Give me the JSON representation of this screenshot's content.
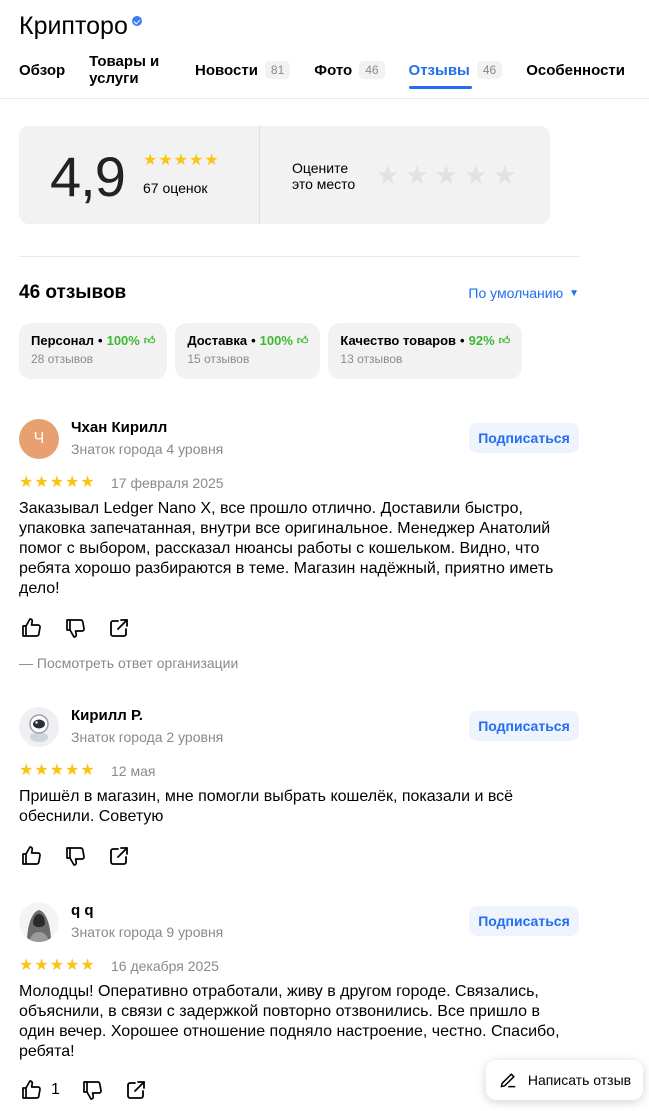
{
  "header": {
    "title": "Крипторо",
    "verified_icon": "verified-check-icon",
    "tabs": [
      {
        "label": "Обзор",
        "count": ""
      },
      {
        "label": "Товары и услуги",
        "count": ""
      },
      {
        "label": "Новости",
        "count": "81"
      },
      {
        "label": "Фото",
        "count": "46"
      },
      {
        "label": "Отзывы",
        "count": "46"
      },
      {
        "label": "Особенности",
        "count": ""
      }
    ],
    "active_tab": "Отзывы"
  },
  "rating": {
    "value": "4,9",
    "stars": 5,
    "count_label": "67 оценок",
    "rate_prompt_line1": "Оцените",
    "rate_prompt_line2": "это место",
    "rate_stars": 5
  },
  "reviews_section": {
    "title": "46 отзывов",
    "sort_label": "По умолчанию",
    "aspects": [
      {
        "name": "Персонал",
        "percent": "100%",
        "count": "28 отзывов"
      },
      {
        "name": "Доставка",
        "percent": "100%",
        "count": "15 отзывов"
      },
      {
        "name": "Качество товаров",
        "percent": "92%",
        "count": "13 отзывов"
      }
    ]
  },
  "reviews": [
    {
      "avatar_letter": "Ч",
      "name": "Чхан Кирилл",
      "level": "Знаток города 4 уровня",
      "subscribe_label": "Подписаться",
      "stars": 5,
      "date": "17 февраля 2025",
      "text": "Заказывал Ledger Nano X, все прошло отлично. Доставили быстро, упаковка запечатанная, внутри все оригинальное. Менеджер Анатолий помог с выбором, рассказал нюансы работы с кошельком. Видно, что ребята хорошо разбираются в теме. Магазин надёжный, приятно иметь дело!",
      "likes": "",
      "org_answer_label": "— Посмотреть ответ организации"
    },
    {
      "avatar_letter": "",
      "name": "Кирилл Р.",
      "level": "Знаток города 2 уровня",
      "subscribe_label": "Подписаться",
      "stars": 5,
      "date": "12 мая",
      "text": "Пришёл в магазин, мне помогли выбрать кошелёк, показали и всё обеснили. Советую",
      "likes": ""
    },
    {
      "avatar_letter": "",
      "name": "q q",
      "level": "Знаток города 9 уровня",
      "subscribe_label": "Подписаться",
      "stars": 5,
      "date": "16 декабря 2025",
      "text": "Молодцы! Оперативно отработали, живу в другом городе. Связались, объяснили, в связи с задержкой повторно отзвонились. Все пришло в один вечер. Хорошее отношение подняло настроение, честно. Спасибо, ребята!",
      "likes": "1"
    }
  ],
  "write_review_label": "Написать отзыв",
  "colors": {
    "accent": "#1f6ff0",
    "star": "#fac415",
    "positive": "#3eb833",
    "muted": "#8a8a8a"
  }
}
